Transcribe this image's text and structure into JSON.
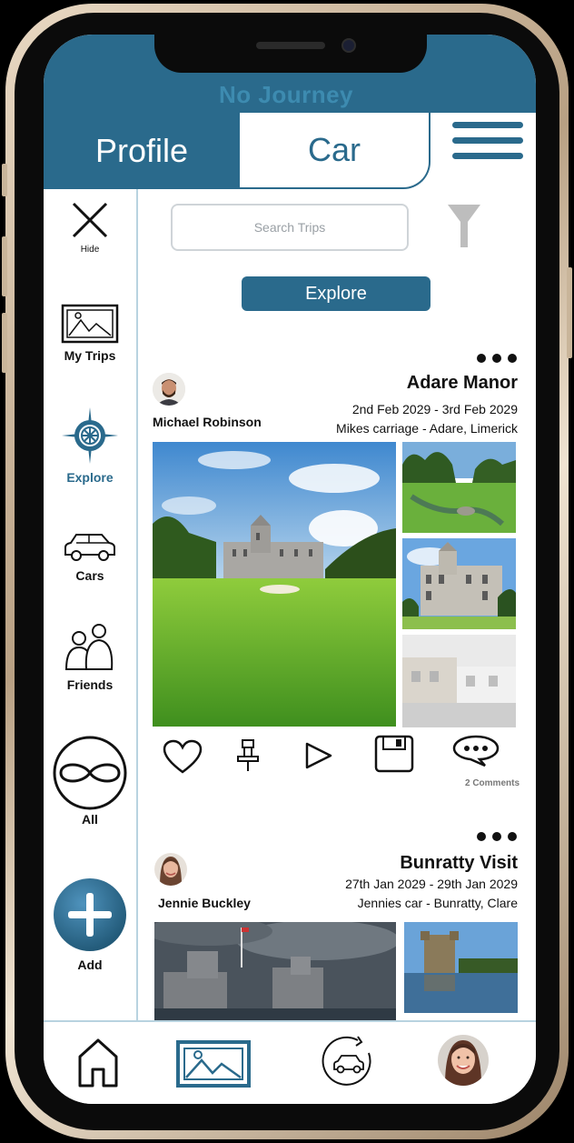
{
  "app": {
    "title": "No Journey"
  },
  "tabs": {
    "profile": "Profile",
    "car": "Car"
  },
  "sidebar": {
    "hide": "Hide",
    "my_trips": "My Trips",
    "explore": "Explore",
    "cars": "Cars",
    "friends": "Friends",
    "all": "All",
    "add": "Add"
  },
  "search": {
    "placeholder": "Search Trips"
  },
  "explore_button": "Explore",
  "posts": [
    {
      "title": "Adare Manor",
      "dates": "2nd Feb 2029 - 3rd Feb 2029",
      "where": "Mikes carriage - Adare, Limerick",
      "author": "Michael Robinson",
      "comments": "2 Comments"
    },
    {
      "title": "Bunratty Visit",
      "dates": "27th Jan 2029 - 29th Jan 2029",
      "where": "Jennies car - Bunratty, Clare",
      "author": "Jennie Buckley"
    }
  ],
  "colors": {
    "primary": "#2a6a8c",
    "accent_light": "#3d8bb0",
    "divider": "#b8d3e0"
  },
  "icons": [
    "close-icon",
    "gallery-icon",
    "compass-icon",
    "car-icon",
    "friends-icon",
    "infinity-icon",
    "plus-icon",
    "heart-icon",
    "pin-icon",
    "play-icon",
    "save-icon",
    "comment-icon",
    "home-icon",
    "trip-cycle-icon",
    "profile-avatar"
  ]
}
